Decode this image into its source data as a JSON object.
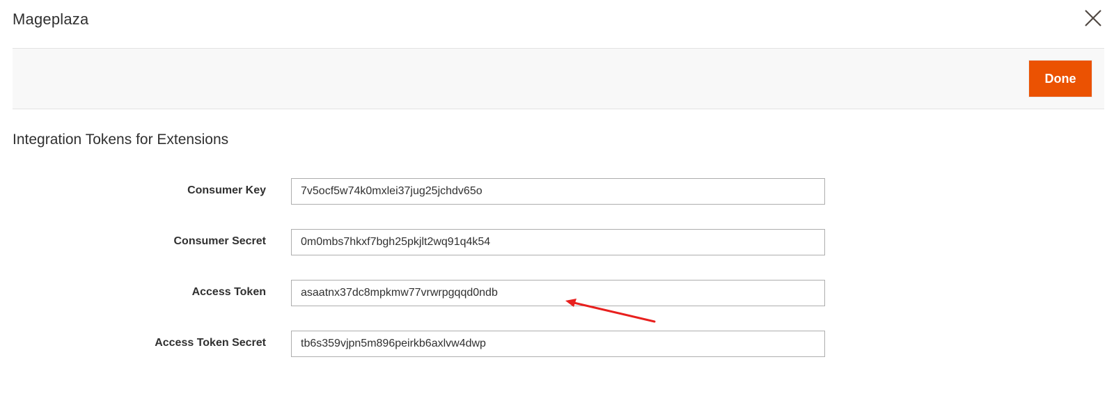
{
  "modal": {
    "title": "Mageplaza",
    "close_icon": "close-icon"
  },
  "action_bar": {
    "done_label": "Done",
    "done_color": "#eb5202"
  },
  "section": {
    "title": "Integration Tokens for Extensions"
  },
  "fields": [
    {
      "label": "Consumer Key",
      "value": "7v5ocf5w74k0mxlei37jug25jchdv65o"
    },
    {
      "label": "Consumer Secret",
      "value": "0m0mbs7hkxf7bgh25pkjlt2wq91q4k54"
    },
    {
      "label": "Access Token",
      "value": "asaatnx37dc8mpkmw77vrwrpgqqd0ndb"
    },
    {
      "label": "Access Token Secret",
      "value": "tb6s359vjpn5m896peirkb6axlvw4dwp"
    }
  ],
  "annotation": {
    "arrow_color": "#e8201e",
    "arrow_icon": "arrow-annotation"
  }
}
